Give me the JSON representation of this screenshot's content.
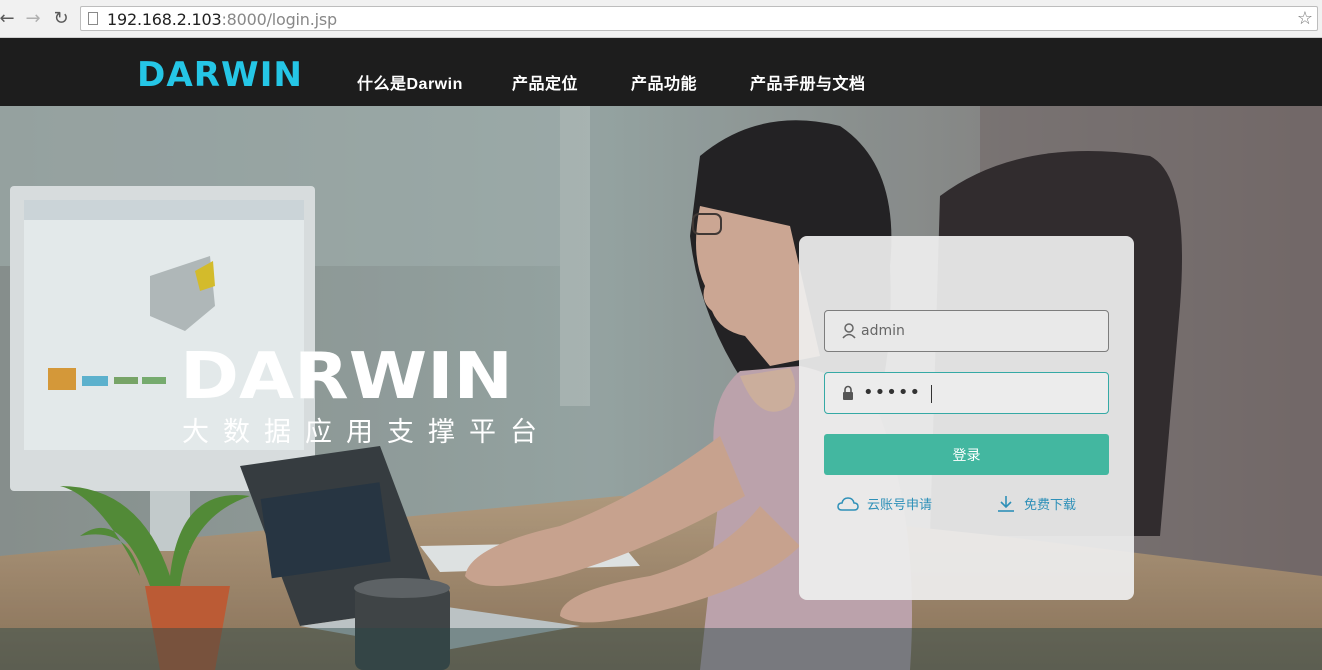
{
  "browser": {
    "url_host": "192.168.2.103",
    "url_rest": ":8000/login.jsp",
    "icons": [
      "back-arrow-icon",
      "forward-arrow-icon",
      "reload-icon",
      "page-icon",
      "bookmark-star-icon"
    ]
  },
  "header": {
    "logo_text": "DARWIN",
    "nav": [
      {
        "label": "什么是Darwin"
      },
      {
        "label": "产品定位"
      },
      {
        "label": "产品功能"
      },
      {
        "label": "产品手册与文档"
      }
    ]
  },
  "hero": {
    "brand": "DARWIN",
    "tagline": "大数据应用支撑平台"
  },
  "login": {
    "username_value": "admin",
    "password_mask": "•••••",
    "submit_label": "登录",
    "cloud_link": "云账号申请",
    "download_link": "免费下载"
  },
  "colors": {
    "header_bg": "#1d1d1d",
    "logo_cyan": "#25c6e6",
    "button_teal": "#43b7a0",
    "link_blue": "#2e90b8"
  }
}
